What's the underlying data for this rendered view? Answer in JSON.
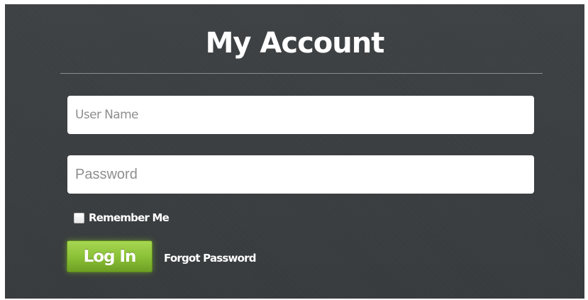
{
  "form": {
    "title": "My Account",
    "username_placeholder": "User Name",
    "username_value": "",
    "password_placeholder": "Password",
    "password_value": "",
    "remember_label": "Remember Me",
    "remember_checked": false,
    "login_label": "Log In",
    "forgot_label": "Forgot Password"
  },
  "colors": {
    "panel_background": "#3a3d3f",
    "login_button": "#8cc238",
    "text": "#ffffff"
  }
}
